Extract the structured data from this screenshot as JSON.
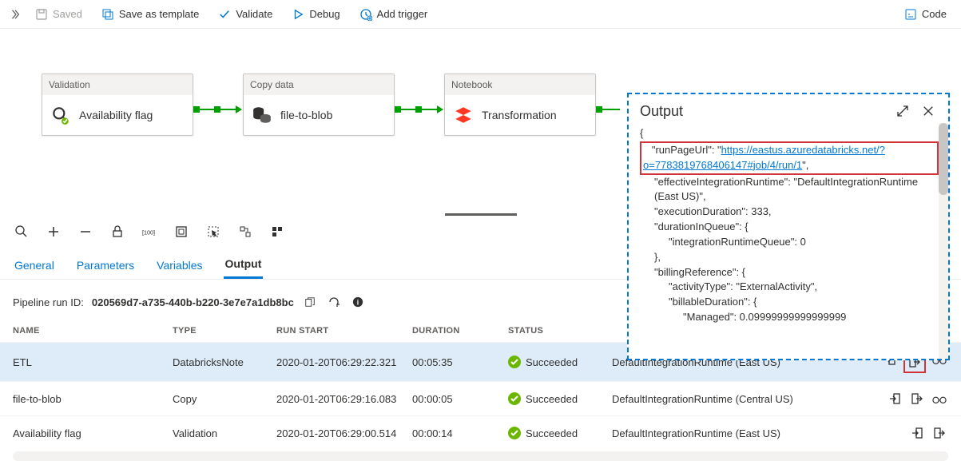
{
  "toolbar": {
    "saved": "Saved",
    "saveAsTemplate": "Save as template",
    "validate": "Validate",
    "debug": "Debug",
    "addTrigger": "Add trigger",
    "code": "Code"
  },
  "activities": [
    {
      "type": "Validation",
      "name": "Availability flag"
    },
    {
      "type": "Copy data",
      "name": "file-to-blob"
    },
    {
      "type": "Notebook",
      "name": "Transformation"
    }
  ],
  "tabs": {
    "general": "General",
    "parameters": "Parameters",
    "variables": "Variables",
    "output": "Output"
  },
  "runid": {
    "label": "Pipeline run ID:",
    "value": "020569d7-a735-440b-b220-3e7e7a1db8bc"
  },
  "columns": {
    "name": "NAME",
    "type": "TYPE",
    "start": "RUN START",
    "duration": "DURATION",
    "status": "STATUS"
  },
  "rows": [
    {
      "name": "ETL",
      "type": "DatabricksNote",
      "start": "2020-01-20T06:29:22.321",
      "duration": "00:05:35",
      "status": "Succeeded",
      "runtime": "DefaultIntegrationRuntime (East US)"
    },
    {
      "name": "file-to-blob",
      "type": "Copy",
      "start": "2020-01-20T06:29:16.083",
      "duration": "00:00:05",
      "status": "Succeeded",
      "runtime": "DefaultIntegrationRuntime (Central US)"
    },
    {
      "name": "Availability flag",
      "type": "Validation",
      "start": "2020-01-20T06:29:00.514",
      "duration": "00:00:14",
      "status": "Succeeded",
      "runtime": "DefaultIntegrationRuntime (East US)"
    }
  ],
  "output": {
    "title": "Output",
    "json": {
      "open": "{",
      "key1": "\"runPageUrl\": \"",
      "link": "https://eastus.azuredatabricks.net/?o=7783819768406147#job/4/run/1",
      "key1end": "\",",
      "line2": "\"effectiveIntegrationRuntime\": \"DefaultIntegrationRuntime (East US)\",",
      "line3": "\"executionDuration\": 333,",
      "line4": "\"durationInQueue\": {",
      "line5": "\"integrationRuntimeQueue\": 0",
      "line6": "},",
      "line7": "\"billingReference\": {",
      "line8": "\"activityType\": \"ExternalActivity\",",
      "line9": "\"billableDuration\": {",
      "line10": "\"Managed\": 0.09999999999999999"
    }
  }
}
